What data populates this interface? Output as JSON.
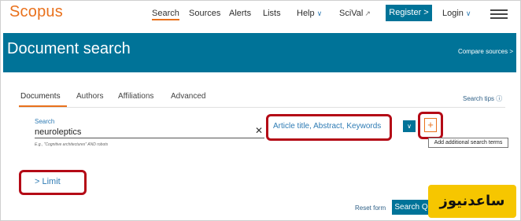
{
  "header": {
    "logo": "Scopus",
    "nav": {
      "search": "Search",
      "sources": "Sources",
      "alerts": "Alerts",
      "lists": "Lists",
      "help": "Help",
      "scival": "SciVal",
      "register": "Register >",
      "login": "Login"
    }
  },
  "banner": {
    "title": "Document search",
    "compare": "Compare sources >"
  },
  "tabs": {
    "documents": "Documents",
    "authors": "Authors",
    "affiliations": "Affiliations",
    "advanced": "Advanced",
    "search_tips": "Search tips ⓘ"
  },
  "search": {
    "label": "Search",
    "value": "neuroleptics",
    "example": "E.g., \"Cognitive architectures\" AND robots",
    "field": "Article title, Abstract, Keywords",
    "tooltip": "Add additional search terms"
  },
  "footer": {
    "limit": "> Limit",
    "reset": "Reset form",
    "search_button": "Search Q"
  },
  "watermark": "ساعدنیوز",
  "colors": {
    "brand_orange": "#e9711c",
    "brand_teal": "#007398",
    "highlight_red": "#b40a16"
  }
}
